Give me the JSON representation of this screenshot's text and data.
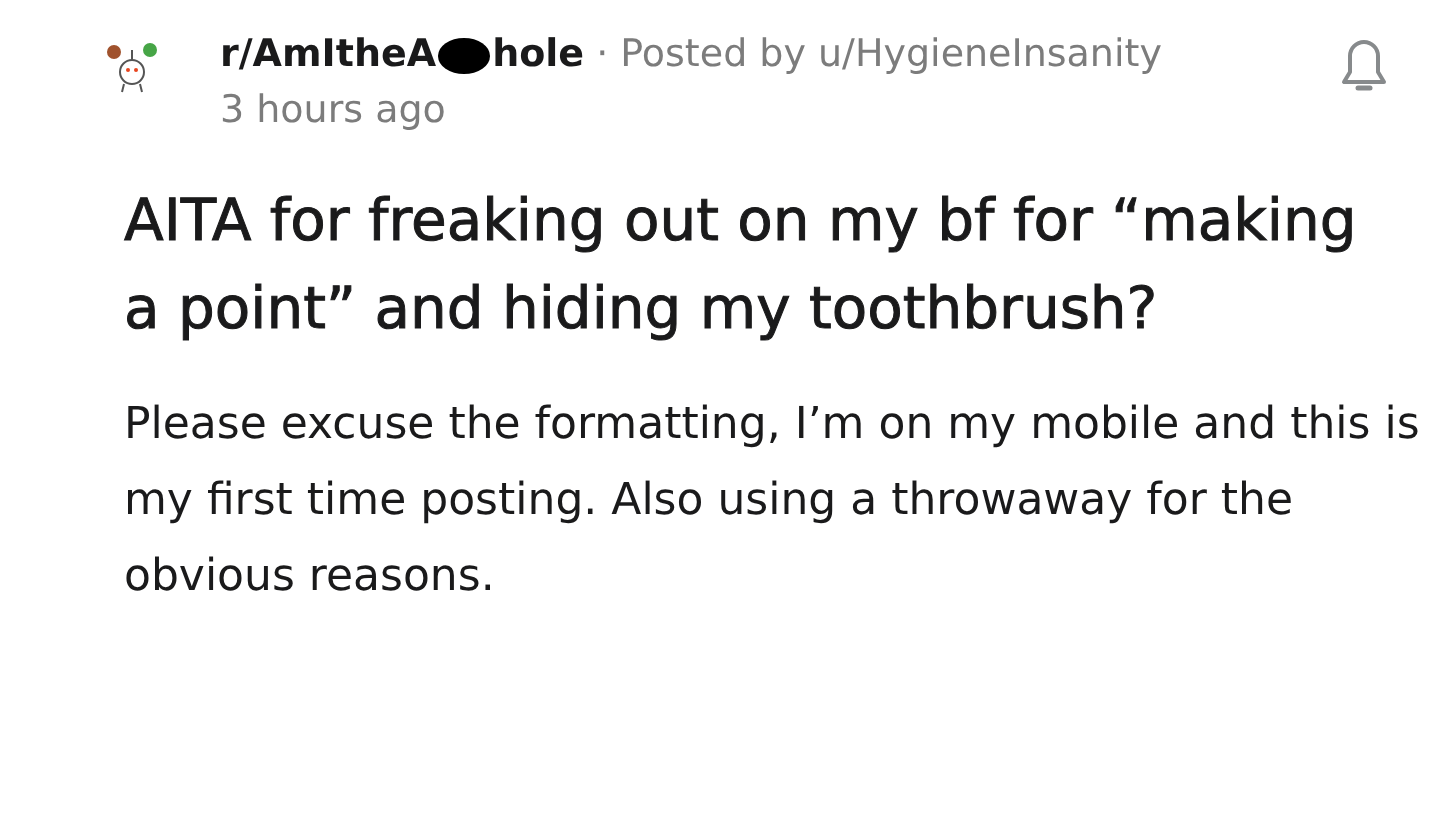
{
  "post": {
    "subreddit_before_redaction": "r/AmItheA",
    "subreddit_after_redaction": "hole",
    "redacted": true,
    "separator": "·",
    "posted_by": "Posted by u/HygieneInsanity",
    "time": "3 hours ago",
    "title": "AITA for freaking out on my bf for “making a point” and hiding my toothbrush?",
    "body": "Please excuse the formatting, I’m on my mobile and this is my first time posting. Also using a throwaway for the obvious reasons."
  }
}
